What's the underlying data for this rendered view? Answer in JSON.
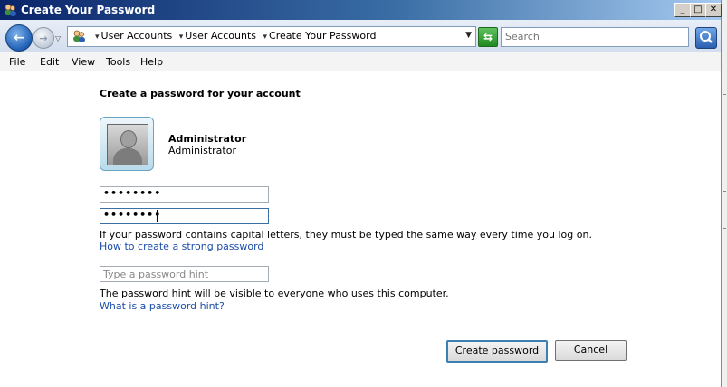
{
  "window": {
    "title": "Create Your Password"
  },
  "address": {
    "crumbs": [
      "User Accounts",
      "User Accounts",
      "Create Your Password"
    ]
  },
  "search": {
    "placeholder": "Search"
  },
  "menu": [
    "File",
    "Edit",
    "View",
    "Tools",
    "Help"
  ],
  "content": {
    "heading": "Create a password for your account",
    "user": {
      "name": "Administrator",
      "role": "Administrator"
    },
    "password_mask": "••••••••",
    "confirm_mask": "••••••••",
    "caps_note": "If your password contains capital letters, they must be typed the same way every time you log on.",
    "strong_link": "How to create a strong password",
    "hint_placeholder": "Type a password hint",
    "hint_note": "The password hint will be visible to everyone who uses this computer.",
    "hint_link": "What is a password hint?"
  },
  "buttons": {
    "create": "Create password",
    "cancel": "Cancel"
  },
  "icons": {
    "app": "users-icon",
    "back": "back-arrow-icon",
    "forward": "forward-arrow-icon",
    "location": "users-icon",
    "refresh": "refresh-icon",
    "search": "search-icon"
  }
}
